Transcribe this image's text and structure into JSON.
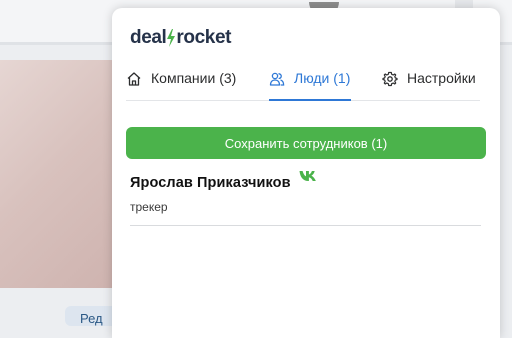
{
  "background": {
    "bottom_button_label": "Ред"
  },
  "popup": {
    "logo": {
      "part1": "deal",
      "part2": "rocket"
    },
    "tabs": [
      {
        "label": "Компании (3)",
        "icon": "home-icon",
        "active": false
      },
      {
        "label": "Люди (1)",
        "icon": "people-icon",
        "active": true
      },
      {
        "label": "Настройки",
        "icon": "gear-icon",
        "active": false
      }
    ],
    "save_button_label": "Сохранить сотрудников (1)",
    "people": [
      {
        "name": "Ярослав Приказчиков",
        "role": "трекер",
        "social_icon": "vk-icon"
      }
    ]
  },
  "colors": {
    "accent": "#2e78d6",
    "save_button": "#4bb34b",
    "vk_green": "#4bb34b",
    "logo": "#253249"
  }
}
